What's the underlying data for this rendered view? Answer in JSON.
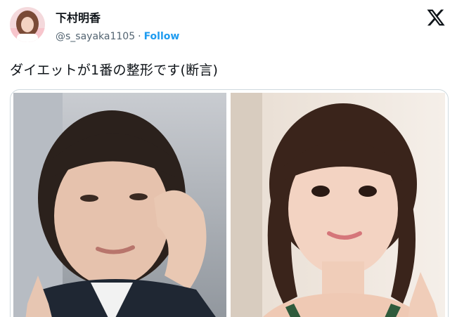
{
  "author": {
    "display_name": "下村明香",
    "handle": "@s_sayaka1105",
    "separator": "·",
    "follow_label": "Follow"
  },
  "brand": {
    "logo": "x-logo-icon",
    "color": "#0f1419"
  },
  "tweet": {
    "text": "ダイエットが1番の整形です(断言)"
  },
  "media": {
    "images": [
      {
        "name": "before-photo"
      },
      {
        "name": "after-photo"
      }
    ]
  },
  "colors": {
    "link": "#1d9bf0",
    "secondary_text": "#536471",
    "border": "#cfd9de"
  }
}
